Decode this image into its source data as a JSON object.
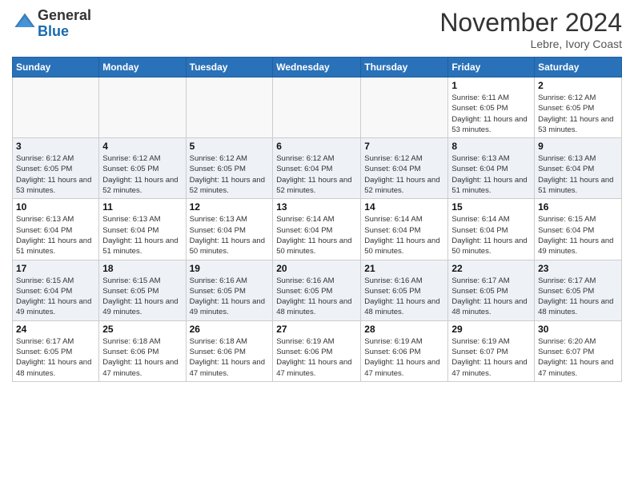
{
  "logo": {
    "general": "General",
    "blue": "Blue"
  },
  "header": {
    "month": "November 2024",
    "location": "Lebre, Ivory Coast"
  },
  "weekdays": [
    "Sunday",
    "Monday",
    "Tuesday",
    "Wednesday",
    "Thursday",
    "Friday",
    "Saturday"
  ],
  "weeks": [
    [
      {
        "day": "",
        "empty": true
      },
      {
        "day": "",
        "empty": true
      },
      {
        "day": "",
        "empty": true
      },
      {
        "day": "",
        "empty": true
      },
      {
        "day": "",
        "empty": true
      },
      {
        "day": "1",
        "sunrise": "Sunrise: 6:11 AM",
        "sunset": "Sunset: 6:05 PM",
        "daylight": "Daylight: 11 hours and 53 minutes."
      },
      {
        "day": "2",
        "sunrise": "Sunrise: 6:12 AM",
        "sunset": "Sunset: 6:05 PM",
        "daylight": "Daylight: 11 hours and 53 minutes."
      }
    ],
    [
      {
        "day": "3",
        "sunrise": "Sunrise: 6:12 AM",
        "sunset": "Sunset: 6:05 PM",
        "daylight": "Daylight: 11 hours and 53 minutes."
      },
      {
        "day": "4",
        "sunrise": "Sunrise: 6:12 AM",
        "sunset": "Sunset: 6:05 PM",
        "daylight": "Daylight: 11 hours and 52 minutes."
      },
      {
        "day": "5",
        "sunrise": "Sunrise: 6:12 AM",
        "sunset": "Sunset: 6:05 PM",
        "daylight": "Daylight: 11 hours and 52 minutes."
      },
      {
        "day": "6",
        "sunrise": "Sunrise: 6:12 AM",
        "sunset": "Sunset: 6:04 PM",
        "daylight": "Daylight: 11 hours and 52 minutes."
      },
      {
        "day": "7",
        "sunrise": "Sunrise: 6:12 AM",
        "sunset": "Sunset: 6:04 PM",
        "daylight": "Daylight: 11 hours and 52 minutes."
      },
      {
        "day": "8",
        "sunrise": "Sunrise: 6:13 AM",
        "sunset": "Sunset: 6:04 PM",
        "daylight": "Daylight: 11 hours and 51 minutes."
      },
      {
        "day": "9",
        "sunrise": "Sunrise: 6:13 AM",
        "sunset": "Sunset: 6:04 PM",
        "daylight": "Daylight: 11 hours and 51 minutes."
      }
    ],
    [
      {
        "day": "10",
        "sunrise": "Sunrise: 6:13 AM",
        "sunset": "Sunset: 6:04 PM",
        "daylight": "Daylight: 11 hours and 51 minutes."
      },
      {
        "day": "11",
        "sunrise": "Sunrise: 6:13 AM",
        "sunset": "Sunset: 6:04 PM",
        "daylight": "Daylight: 11 hours and 51 minutes."
      },
      {
        "day": "12",
        "sunrise": "Sunrise: 6:13 AM",
        "sunset": "Sunset: 6:04 PM",
        "daylight": "Daylight: 11 hours and 50 minutes."
      },
      {
        "day": "13",
        "sunrise": "Sunrise: 6:14 AM",
        "sunset": "Sunset: 6:04 PM",
        "daylight": "Daylight: 11 hours and 50 minutes."
      },
      {
        "day": "14",
        "sunrise": "Sunrise: 6:14 AM",
        "sunset": "Sunset: 6:04 PM",
        "daylight": "Daylight: 11 hours and 50 minutes."
      },
      {
        "day": "15",
        "sunrise": "Sunrise: 6:14 AM",
        "sunset": "Sunset: 6:04 PM",
        "daylight": "Daylight: 11 hours and 50 minutes."
      },
      {
        "day": "16",
        "sunrise": "Sunrise: 6:15 AM",
        "sunset": "Sunset: 6:04 PM",
        "daylight": "Daylight: 11 hours and 49 minutes."
      }
    ],
    [
      {
        "day": "17",
        "sunrise": "Sunrise: 6:15 AM",
        "sunset": "Sunset: 6:04 PM",
        "daylight": "Daylight: 11 hours and 49 minutes."
      },
      {
        "day": "18",
        "sunrise": "Sunrise: 6:15 AM",
        "sunset": "Sunset: 6:05 PM",
        "daylight": "Daylight: 11 hours and 49 minutes."
      },
      {
        "day": "19",
        "sunrise": "Sunrise: 6:16 AM",
        "sunset": "Sunset: 6:05 PM",
        "daylight": "Daylight: 11 hours and 49 minutes."
      },
      {
        "day": "20",
        "sunrise": "Sunrise: 6:16 AM",
        "sunset": "Sunset: 6:05 PM",
        "daylight": "Daylight: 11 hours and 48 minutes."
      },
      {
        "day": "21",
        "sunrise": "Sunrise: 6:16 AM",
        "sunset": "Sunset: 6:05 PM",
        "daylight": "Daylight: 11 hours and 48 minutes."
      },
      {
        "day": "22",
        "sunrise": "Sunrise: 6:17 AM",
        "sunset": "Sunset: 6:05 PM",
        "daylight": "Daylight: 11 hours and 48 minutes."
      },
      {
        "day": "23",
        "sunrise": "Sunrise: 6:17 AM",
        "sunset": "Sunset: 6:05 PM",
        "daylight": "Daylight: 11 hours and 48 minutes."
      }
    ],
    [
      {
        "day": "24",
        "sunrise": "Sunrise: 6:17 AM",
        "sunset": "Sunset: 6:05 PM",
        "daylight": "Daylight: 11 hours and 48 minutes."
      },
      {
        "day": "25",
        "sunrise": "Sunrise: 6:18 AM",
        "sunset": "Sunset: 6:06 PM",
        "daylight": "Daylight: 11 hours and 47 minutes."
      },
      {
        "day": "26",
        "sunrise": "Sunrise: 6:18 AM",
        "sunset": "Sunset: 6:06 PM",
        "daylight": "Daylight: 11 hours and 47 minutes."
      },
      {
        "day": "27",
        "sunrise": "Sunrise: 6:19 AM",
        "sunset": "Sunset: 6:06 PM",
        "daylight": "Daylight: 11 hours and 47 minutes."
      },
      {
        "day": "28",
        "sunrise": "Sunrise: 6:19 AM",
        "sunset": "Sunset: 6:06 PM",
        "daylight": "Daylight: 11 hours and 47 minutes."
      },
      {
        "day": "29",
        "sunrise": "Sunrise: 6:19 AM",
        "sunset": "Sunset: 6:07 PM",
        "daylight": "Daylight: 11 hours and 47 minutes."
      },
      {
        "day": "30",
        "sunrise": "Sunrise: 6:20 AM",
        "sunset": "Sunset: 6:07 PM",
        "daylight": "Daylight: 11 hours and 47 minutes."
      }
    ]
  ]
}
